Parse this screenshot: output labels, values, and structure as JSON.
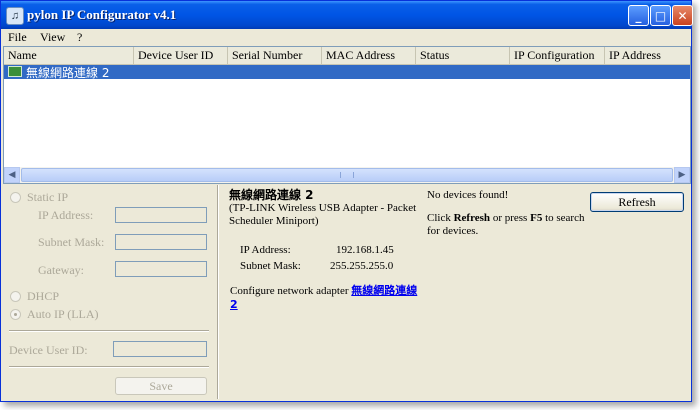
{
  "window": {
    "title": "pylon IP Configurator v4.1",
    "minimize": "_",
    "maximize": "□",
    "close": "✕",
    "app_icon": "♫"
  },
  "menu": {
    "file": "File",
    "view": "View",
    "help": "?"
  },
  "table": {
    "columns": [
      "Name",
      "Device User ID",
      "Serial Number",
      "MAC Address",
      "Status",
      "IP Configuration",
      "IP Address"
    ],
    "rows": [
      {
        "name": "無線網路連線 2",
        "icon": "network-adapter-icon"
      }
    ]
  },
  "scrollbar": {
    "left_arrow": "◀",
    "right_arrow": "▶"
  },
  "settings": {
    "static_ip": "Static IP",
    "ip_address": "IP Address:",
    "subnet_mask": "Subnet Mask:",
    "gateway": "Gateway:",
    "dhcp": "DHCP",
    "auto_ip": "Auto IP (LLA)",
    "device_user_id": "Device User ID:",
    "save": "Save"
  },
  "adapter": {
    "name": "無線網路連線 2",
    "description": "(TP-LINK Wireless USB Adapter - Packet Scheduler Miniport)",
    "ip_label": "IP Address:",
    "ip_value": "192.168.1.45",
    "mask_label": "Subnet Mask:",
    "mask_value": "255.255.255.0",
    "configure_prefix": "Configure network adapter",
    "configure_link": "無線網路連線 2"
  },
  "info": {
    "no_devices": "No devices found!",
    "hint_click": "Click",
    "hint_refresh": "Refresh",
    "hint_or": "or press",
    "hint_f5": "F5",
    "hint_to": "to",
    "hint_rest": "search for devices.",
    "refresh_button": "Refresh"
  }
}
